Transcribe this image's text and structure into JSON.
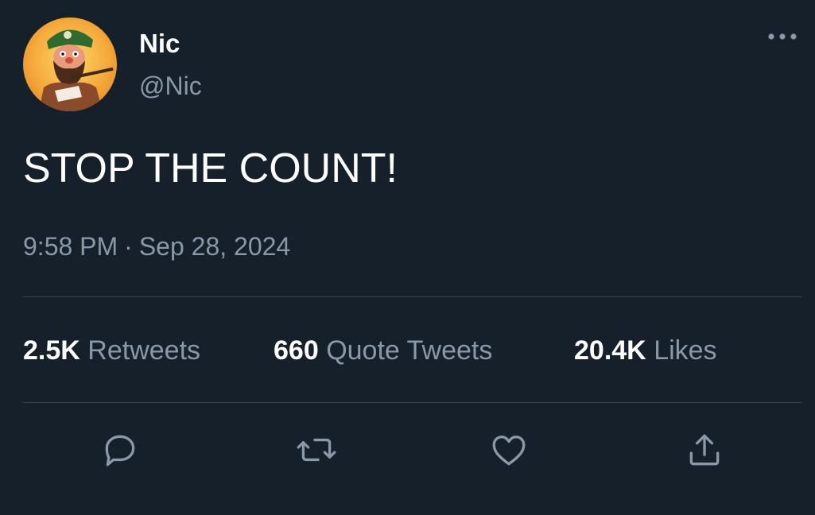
{
  "author": {
    "name": "Nic",
    "handle": "@Nic",
    "avatar_icon": "avatar-bearded-man-illustration"
  },
  "tweet": {
    "text": "STOP THE COUNT!",
    "time": "9:58 PM",
    "separator": "·",
    "date": "Sep 28, 2024"
  },
  "stats": {
    "retweets_count": "2.5K",
    "retweets_label": "Retweets",
    "quotes_count": "660",
    "quotes_label": "Quote Tweets",
    "likes_count": "20.4K",
    "likes_label": "Likes"
  },
  "actions": [
    {
      "name": "reply",
      "icon": "reply-icon"
    },
    {
      "name": "retweet",
      "icon": "retweet-icon"
    },
    {
      "name": "like",
      "icon": "heart-icon"
    },
    {
      "name": "share",
      "icon": "share-icon"
    }
  ],
  "colors": {
    "background": "#15202b",
    "primary_text": "#ffffff",
    "secondary_text": "#8b98a5",
    "divider": "#38444d",
    "icon": "#8b98a5"
  }
}
